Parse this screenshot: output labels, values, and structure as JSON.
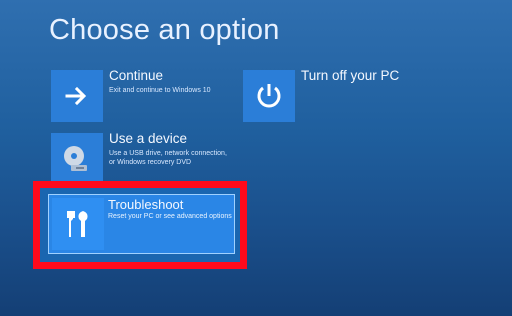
{
  "header": {
    "title": "Choose an option"
  },
  "options": [
    {
      "key": "continue",
      "label": "Continue",
      "description": "Exit and continue to Windows 10",
      "icon": "arrow-right-icon"
    },
    {
      "key": "turn_off",
      "label": "Turn off your PC",
      "description": "",
      "icon": "power-icon"
    },
    {
      "key": "use_device",
      "label": "Use a device",
      "description": "Use a USB drive, network connection, or Windows recovery DVD",
      "icon": "disc-drive-icon"
    },
    {
      "key": "troubleshoot",
      "label": "Troubleshoot",
      "description": "Reset your PC or see advanced options",
      "icon": "tools-icon",
      "selected": true
    }
  ],
  "colors": {
    "background_top": "#2f6fb0",
    "background_bottom": "#143f75",
    "tile_blue": "#2b7ed8",
    "selected_tile_blue": "#2a86e6",
    "annotation_red": "#ff0a1c"
  }
}
